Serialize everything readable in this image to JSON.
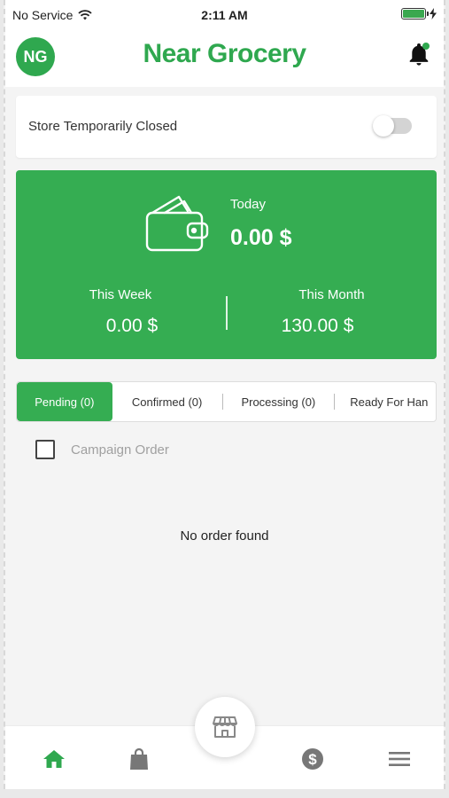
{
  "status_bar": {
    "carrier": "No Service",
    "time": "2:11 AM",
    "battery_level": 1.0,
    "battery_color": "#3aa84f"
  },
  "header": {
    "logo_text": "NG",
    "title": "Near Grocery",
    "notification_icon": "bell-icon",
    "brand_color": "#2fa84f"
  },
  "store": {
    "label": "Store Temporarily Closed",
    "toggle_on": false
  },
  "earnings": {
    "today_label": "Today",
    "today_value": "0.00 $",
    "week_label": "This Week",
    "week_value": "0.00 $",
    "month_label": "This Month",
    "month_value": "130.00 $",
    "icon": "wallet-icon",
    "card_color": "#35ad52"
  },
  "tabs": [
    {
      "label": "Pending (0)",
      "active": true
    },
    {
      "label": "Confirmed (0)",
      "active": false
    },
    {
      "label": "Processing (0)",
      "active": false
    },
    {
      "label": "Ready For Han",
      "active": false
    }
  ],
  "campaign": {
    "label": "Campaign Order",
    "checked": false
  },
  "empty_message": "No order found",
  "bottom_nav": {
    "items": [
      "home-icon",
      "shopping-bag-icon",
      "store-icon",
      "dollar-icon",
      "menu-icon"
    ],
    "active": "home-icon"
  }
}
